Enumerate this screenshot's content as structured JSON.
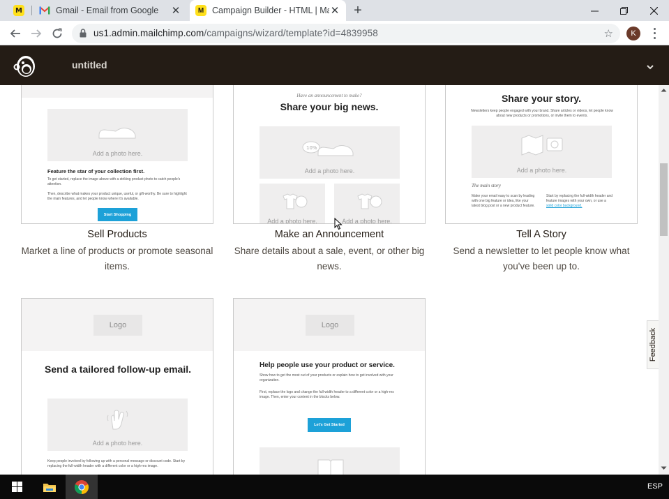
{
  "browser": {
    "tabs": [
      {
        "title": "Gmail - Email from Google",
        "active": false
      },
      {
        "title": "Campaign Builder - HTML | Mailchimp",
        "active": true
      }
    ],
    "url_host": "us1.admin.mailchimp.com",
    "url_path": "/campaigns/wizard/template?id=4839958",
    "profile_initial": "K"
  },
  "app": {
    "campaign_name": "untitled"
  },
  "templates": [
    {
      "title": "Sell Products",
      "desc": "Market a line of products or promote seasonal items.",
      "preview": {
        "photo_caption": "Add a photo here.",
        "heading": "Feature the star of your collection first.",
        "body1": "To get started, replace the image above with a striking product photo to catch people's attention.",
        "body2": "Then, describe what makes your product unique, useful, or gift-worthy. Be sure to highlight the main features, and let people know where it's available.",
        "cta": "Start Shopping"
      }
    },
    {
      "title": "Make an Announcement",
      "desc": "Share details about a sale, event, or other big news.",
      "preview": {
        "kicker": "Have an announcement to make?",
        "heading": "Share your big news.",
        "photo_caption": "Add a photo here.",
        "small_caption_1": "Add a photo here.",
        "small_caption_2": "Add a photo here."
      }
    },
    {
      "title": "Tell A Story",
      "desc": "Send a newsletter to let people know what you've been up to.",
      "preview": {
        "heading": "Share your story.",
        "intro": "Newsletters keep people engaged with your brand. Share articles or videos, let people know about new products or promotions, or invite them to events.",
        "photo_caption": "Add a photo here.",
        "subheading": "The main story",
        "col1": "Make your email easy to scan by leading with one big feature or idea, like your latest blog post or a new product feature.",
        "col2": "Start by replacing the full-width header and feature images with your own, or use a",
        "col2_link": "solid color background."
      }
    },
    {
      "title": "",
      "desc": "",
      "preview": {
        "logo": "Logo",
        "heading": "Send a tailored follow-up email.",
        "photo_caption": "Add a photo here.",
        "body": "Keep people involved by following up with a personal message or discount code. Start by replacing the full-width header with a different color or a high-res image."
      }
    },
    {
      "title": "",
      "desc": "",
      "preview": {
        "logo": "Logo",
        "heading": "Help people use your product or service.",
        "body1": "Show how to get the most out of your products or explain how to get involved with your organization.",
        "body2": "First, replace the logo and change the full-width header to a different color or a high-res image. Then, enter your content in the blocks below.",
        "cta": "Let's Get Started"
      }
    }
  ],
  "feedback_label": "Feedback",
  "taskbar": {
    "language": "ESP"
  },
  "colors": {
    "mailchimp_header": "#241c15",
    "cta_blue": "#1da1d8",
    "mailchimp_yellow": "#ffe01b"
  }
}
